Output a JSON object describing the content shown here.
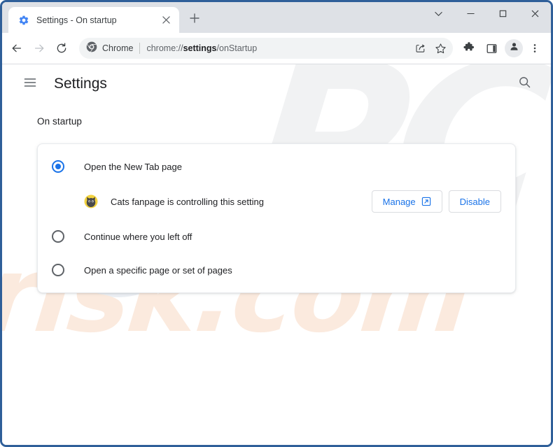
{
  "window": {
    "frame_color": "#2f5f99",
    "controls": [
      {
        "name": "tab-search",
        "icon": "chevron-down-icon"
      },
      {
        "name": "minimize",
        "icon": "minimize-icon"
      },
      {
        "name": "maximize",
        "icon": "maximize-icon"
      },
      {
        "name": "close",
        "icon": "close-icon"
      }
    ]
  },
  "tabstrip": {
    "tab": {
      "title": "Settings - On startup",
      "favicon": "gear-icon",
      "close_icon": "close-icon"
    },
    "new_tab_label": "+",
    "new_tab_icon": "plus-icon"
  },
  "toolbar": {
    "back_icon": "back-arrow-icon",
    "forward_icon": "forward-arrow-icon",
    "reload_icon": "reload-icon",
    "chrome_chip_label": "Chrome",
    "chrome_chip_icon": "chrome-logo-icon",
    "url_prefix": "chrome://",
    "url_bold": "settings",
    "url_suffix": "/onStartup",
    "url_full": "chrome://settings/onStartup",
    "share_icon": "share-icon",
    "bookmark_icon": "star-icon",
    "extensions_icon": "puzzle-piece-icon",
    "side_panel_icon": "side-panel-icon",
    "profile_icon": "avatar-icon",
    "menu_icon": "three-dot-menu-icon"
  },
  "settings": {
    "menu_icon": "hamburger-menu-icon",
    "title": "Settings",
    "search_icon": "search-icon",
    "section_label": "On startup",
    "options": [
      {
        "label": "Open the New Tab page",
        "checked": true
      },
      {
        "label": "Continue where you left off",
        "checked": false
      },
      {
        "label": "Open a specific page or set of pages",
        "checked": false
      }
    ],
    "extension_notice": {
      "icon": "cat-extension-icon",
      "text": "Cats fanpage is controlling this setting",
      "manage_label": "Manage",
      "manage_icon": "external-link-icon",
      "disable_label": "Disable"
    },
    "accent_color": "#1a73e8"
  },
  "watermark": {
    "primary_text": "PC",
    "secondary_text": "risk.com",
    "primary_color": "#f1f2f3",
    "secondary_color": "#fbeade"
  }
}
